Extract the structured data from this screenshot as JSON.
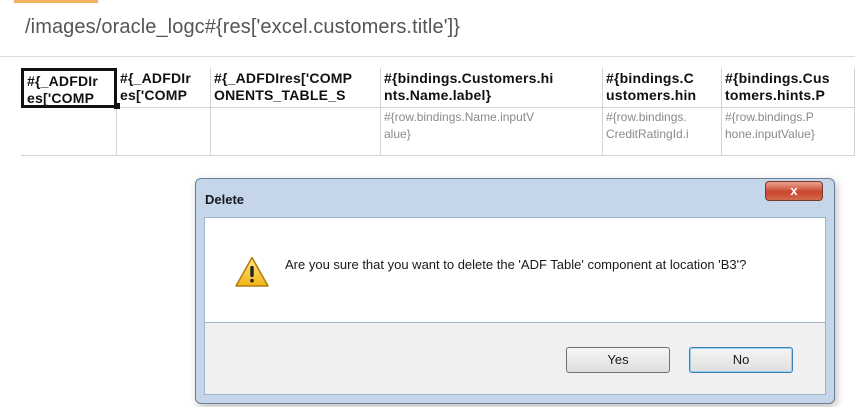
{
  "page": {
    "title": "/images/oracle_logc#{res['excel.customers.title']}"
  },
  "grid": {
    "headers": [
      "#{_ADFDIr\nes['COMP",
      "#{_ADFDIr\nes['COMP",
      "#{_ADFDIres['COMP\nONENTS_TABLE_S",
      "#{bindings.Customers.hi\nnts.Name.label}",
      "#{bindings.C\nustomers.hin",
      "#{bindings.Cus\ntomers.hints.P"
    ],
    "values": [
      "",
      "",
      "",
      "#{row.bindings.Name.inputV\nalue}",
      "#{row.bindings.\nCreditRatingId.i",
      "#{row.bindings.P\nhone.inputValue}"
    ]
  },
  "dialog": {
    "title": "Delete",
    "close_label": "x",
    "message": "Are you sure that you want to delete the 'ADF Table' component at location 'B3'?",
    "icon": "warning-icon",
    "yes_label": "Yes",
    "no_label": "No"
  }
}
